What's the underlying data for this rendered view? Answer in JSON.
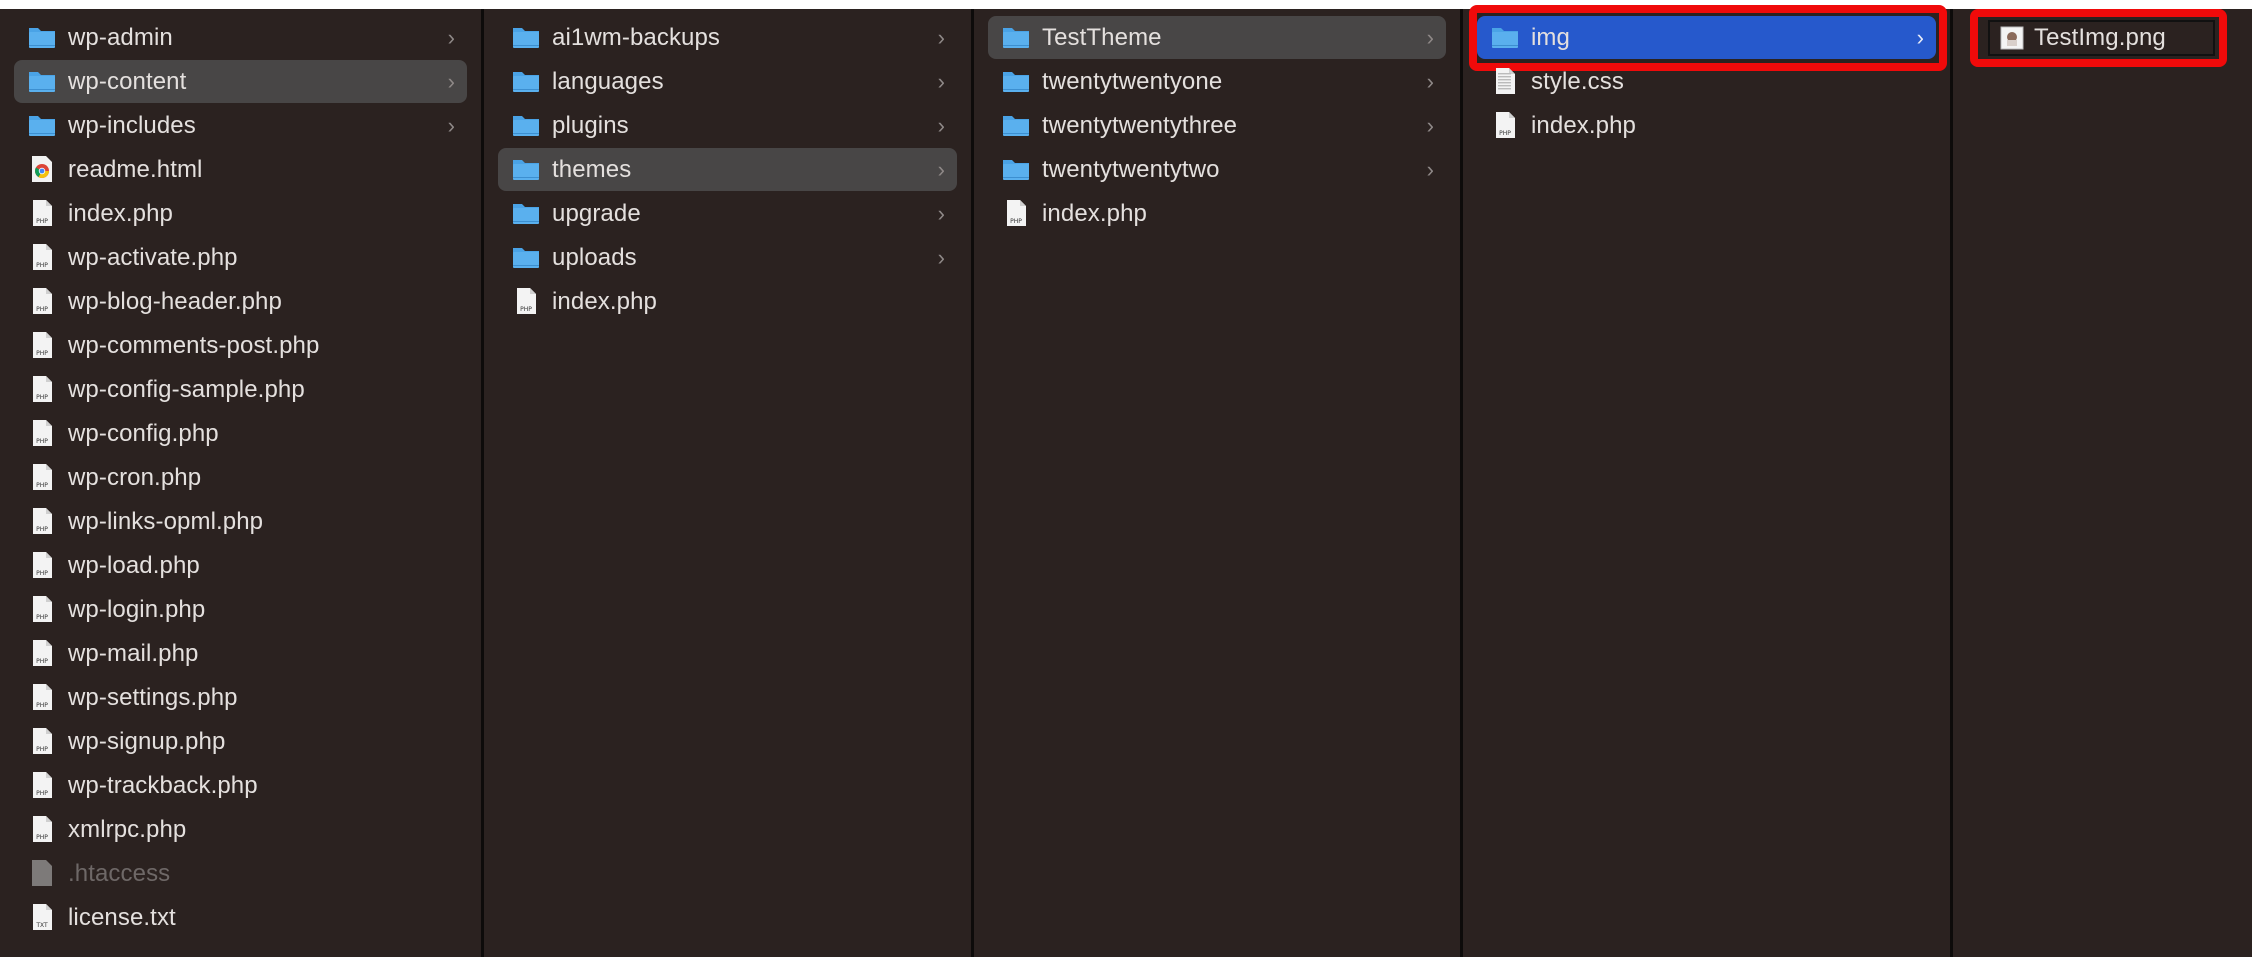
{
  "colors": {
    "background": "#2b2220",
    "selected_row": "#484646",
    "active_row": "#2659cc",
    "folder": "#5ab0ee",
    "highlight_annotation": "#f00a0a"
  },
  "columns": [
    {
      "items": [
        {
          "label": "wp-admin",
          "type": "folder"
        },
        {
          "label": "wp-content",
          "type": "folder",
          "state": "selected"
        },
        {
          "label": "wp-includes",
          "type": "folder"
        },
        {
          "label": "readme.html",
          "type": "html"
        },
        {
          "label": "index.php",
          "type": "php"
        },
        {
          "label": "wp-activate.php",
          "type": "php"
        },
        {
          "label": "wp-blog-header.php",
          "type": "php"
        },
        {
          "label": "wp-comments-post.php",
          "type": "php"
        },
        {
          "label": "wp-config-sample.php",
          "type": "php"
        },
        {
          "label": "wp-config.php",
          "type": "php"
        },
        {
          "label": "wp-cron.php",
          "type": "php"
        },
        {
          "label": "wp-links-opml.php",
          "type": "php"
        },
        {
          "label": "wp-load.php",
          "type": "php"
        },
        {
          "label": "wp-login.php",
          "type": "php"
        },
        {
          "label": "wp-mail.php",
          "type": "php"
        },
        {
          "label": "wp-settings.php",
          "type": "php"
        },
        {
          "label": "wp-signup.php",
          "type": "php"
        },
        {
          "label": "wp-trackback.php",
          "type": "php"
        },
        {
          "label": "xmlrpc.php",
          "type": "php"
        },
        {
          "label": ".htaccess",
          "type": "hidden"
        },
        {
          "label": "license.txt",
          "type": "txt"
        }
      ]
    },
    {
      "items": [
        {
          "label": "ai1wm-backups",
          "type": "folder"
        },
        {
          "label": "languages",
          "type": "folder"
        },
        {
          "label": "plugins",
          "type": "folder"
        },
        {
          "label": "themes",
          "type": "folder",
          "state": "selected"
        },
        {
          "label": "upgrade",
          "type": "folder"
        },
        {
          "label": "uploads",
          "type": "folder"
        },
        {
          "label": "index.php",
          "type": "php"
        }
      ]
    },
    {
      "items": [
        {
          "label": "TestTheme",
          "type": "folder",
          "state": "selected"
        },
        {
          "label": "twentytwentyone",
          "type": "folder"
        },
        {
          "label": "twentytwentythree",
          "type": "folder"
        },
        {
          "label": "twentytwentytwo",
          "type": "folder"
        },
        {
          "label": "index.php",
          "type": "php"
        }
      ]
    },
    {
      "items": [
        {
          "label": "img",
          "type": "folder",
          "state": "active",
          "annotated": true
        },
        {
          "label": "style.css",
          "type": "css"
        },
        {
          "label": "index.php",
          "type": "php"
        }
      ]
    },
    {
      "items": [
        {
          "label": "TestImg.png",
          "type": "png",
          "annotated": true
        }
      ]
    }
  ]
}
